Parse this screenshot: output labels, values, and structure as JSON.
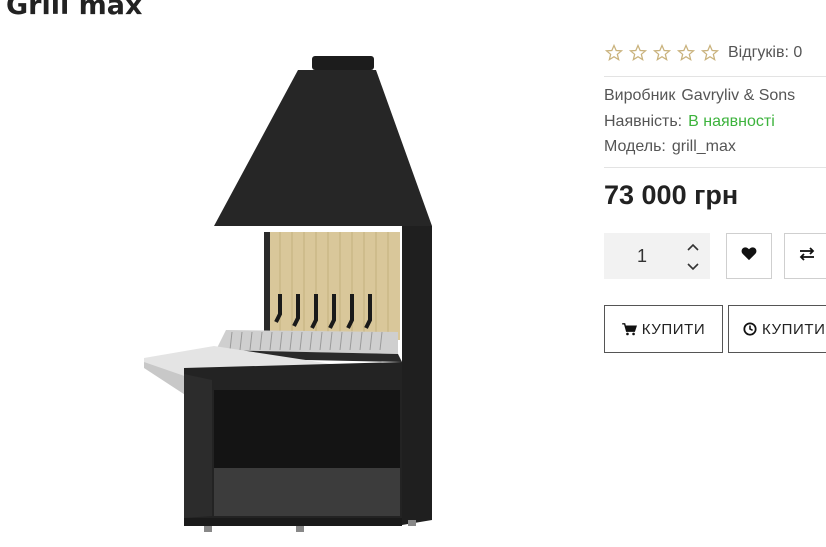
{
  "product": {
    "title": "Grill max",
    "price": "73 000 грн"
  },
  "rating": {
    "stars_filled": 0,
    "stars_total": 5,
    "reviews_label": "Відгуків: 0"
  },
  "meta": {
    "manufacturer_label": "Виробник",
    "manufacturer_value": "Gavryliv & Sons",
    "stock_label": "Наявність:",
    "stock_value": "В наявності",
    "model_label": "Модель:",
    "model_value": "grill_max"
  },
  "cart": {
    "quantity": "1",
    "buy_label": "КУПИТИ",
    "quick_buy_label": "КУПИТИ"
  },
  "icons": {
    "star": "star-outline-icon",
    "qty_up": "chevron-up-icon",
    "qty_down": "chevron-down-icon",
    "wishlist": "heart-icon",
    "compare": "exchange-arrows-icon",
    "cart": "shopping-cart-icon",
    "clock": "clock-icon"
  },
  "colors": {
    "star_outline": "#c9b27c",
    "in_stock": "#3db33d",
    "text": "#333333"
  }
}
